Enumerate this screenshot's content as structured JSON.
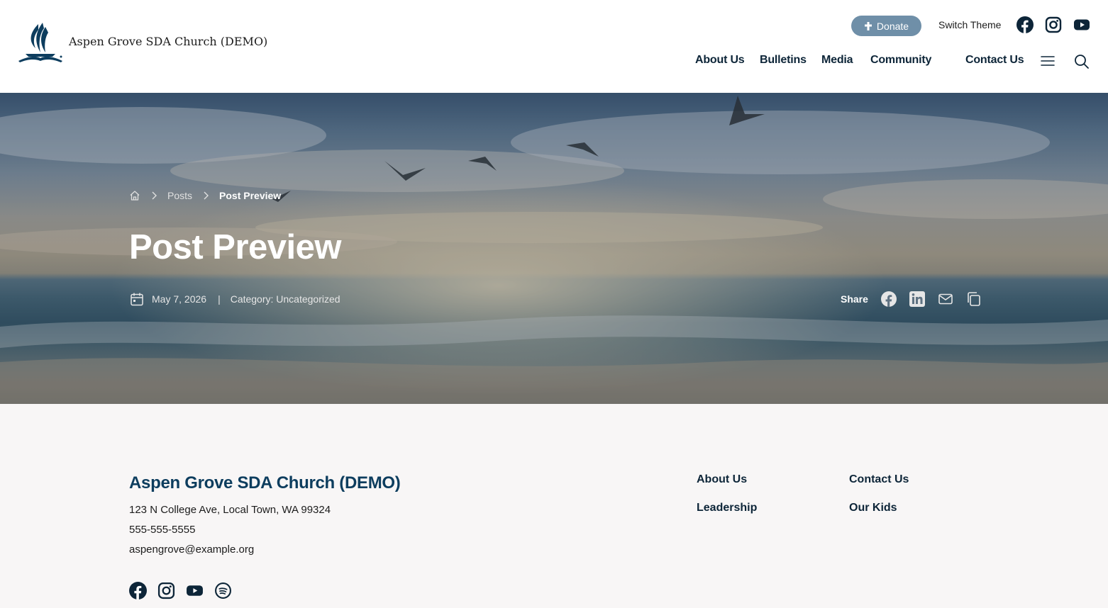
{
  "header": {
    "site_title": "Aspen Grove SDA Church (DEMO)",
    "donate_label": "Donate",
    "switch_theme_label": "Switch Theme",
    "nav": [
      "About Us",
      "Bulletins",
      "Media",
      "Community",
      "Contact Us"
    ]
  },
  "hero": {
    "breadcrumb": {
      "posts_label": "Posts",
      "current_label": "Post Preview"
    },
    "title": "Post Preview",
    "date": "May 7, 2026",
    "separator": "|",
    "category": "Category: Uncategorized",
    "share_label": "Share"
  },
  "footer": {
    "title": "Aspen Grove SDA Church (DEMO)",
    "address": "123 N College Ave, Local Town, WA 99324",
    "phone": "555-555-5555",
    "email": "aspengrove@example.org",
    "links": [
      "About Us",
      "Contact Us",
      "Leadership",
      "Our Kids"
    ]
  },
  "colors": {
    "brand_navy": "#0d2538",
    "footer_title": "#0d3d5e",
    "donate_bg": "#6f8fa8",
    "footer_bg": "#f8f6f6"
  },
  "icons": {
    "top_social": [
      "facebook-icon",
      "instagram-icon",
      "youtube-icon"
    ],
    "share": [
      "facebook-icon",
      "linkedin-icon",
      "mail-icon",
      "copy-icon"
    ],
    "footer_social": [
      "facebook-icon",
      "instagram-icon",
      "youtube-icon",
      "spotify-icon"
    ]
  }
}
